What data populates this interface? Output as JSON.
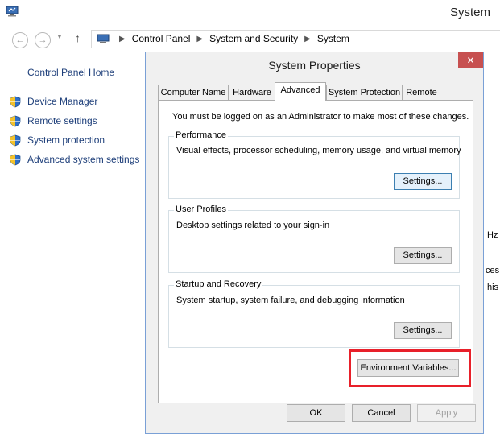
{
  "window": {
    "title": "System",
    "breadcrumbs": [
      "Control Panel",
      "System and Security",
      "System"
    ]
  },
  "sidebar": {
    "home": "Control Panel Home",
    "items": [
      {
        "label": "Device Manager",
        "icon": "shield-icon"
      },
      {
        "label": "Remote settings",
        "icon": "shield-icon"
      },
      {
        "label": "System protection",
        "icon": "shield-icon"
      },
      {
        "label": "Advanced system settings",
        "icon": "shield-icon"
      }
    ]
  },
  "background_fragments": [
    "Hz",
    "ces",
    "his"
  ],
  "dialog": {
    "title": "System Properties",
    "close_label": "✕",
    "tabs": [
      {
        "label": "Computer Name",
        "active": false
      },
      {
        "label": "Hardware",
        "active": false
      },
      {
        "label": "Advanced",
        "active": true
      },
      {
        "label": "System Protection",
        "active": false
      },
      {
        "label": "Remote",
        "active": false
      }
    ],
    "notice": "You must be logged on as an Administrator to make most of these changes.",
    "groups": [
      {
        "title": "Performance",
        "description": "Visual effects, processor scheduling, memory usage, and virtual memory",
        "button": "Settings..."
      },
      {
        "title": "User Profiles",
        "description": "Desktop settings related to your sign-in",
        "button": "Settings..."
      },
      {
        "title": "Startup and Recovery",
        "description": "System startup, system failure, and debugging information",
        "button": "Settings..."
      }
    ],
    "env_button": "Environment Variables...",
    "ok": "OK",
    "cancel": "Cancel",
    "apply": "Apply"
  },
  "colors": {
    "link": "#1e3f7a",
    "close": "#c75050",
    "highlight": "#e8202a"
  }
}
